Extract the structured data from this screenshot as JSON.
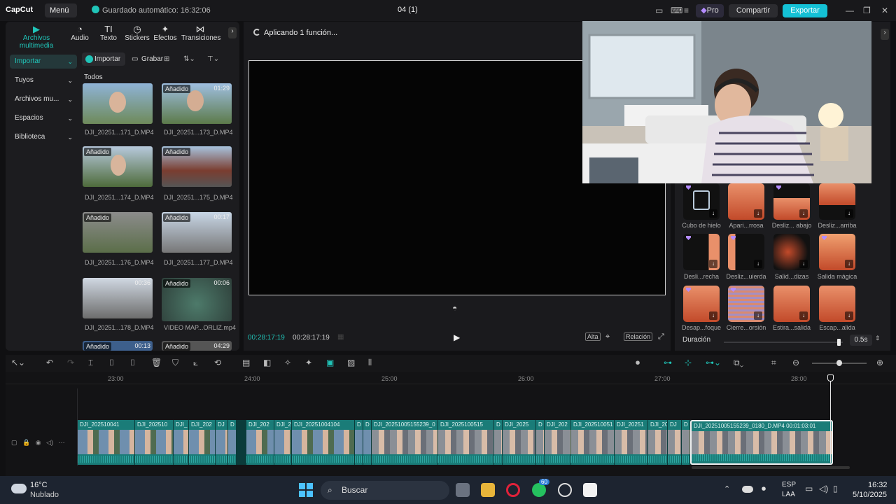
{
  "app": {
    "logo": "CapCut",
    "menu": "Menú",
    "autosave": "Guardado automático: 16:32:06",
    "project_title": "04 (1)",
    "pro": "Pro",
    "share": "Compartir",
    "export": "Exportar"
  },
  "left": {
    "tabs": [
      {
        "label": "Archivos multimedia",
        "icon": "media-icon"
      },
      {
        "label": "Audio",
        "icon": "audio-icon"
      },
      {
        "label": "Texto",
        "icon": "text-icon"
      },
      {
        "label": "Stickers",
        "icon": "sticker-icon"
      },
      {
        "label": "Efectos",
        "icon": "effects-icon"
      },
      {
        "label": "Transiciones",
        "icon": "transitions-icon"
      }
    ],
    "sidebar": [
      "Importar",
      "Tuyos",
      "Archivos mu...",
      "Espacios",
      "Biblioteca"
    ],
    "import_btn": "Importar",
    "record_btn": "Grabar",
    "section": "Todos",
    "media": [
      {
        "name": "DJI_20251...171_D.MP4",
        "badge": "",
        "dur": ""
      },
      {
        "name": "DJI_20251...173_D.MP4",
        "badge": "Añadido",
        "dur": "01:29"
      },
      {
        "name": "DJI_20251...174_D.MP4",
        "badge": "Añadido",
        "dur": ""
      },
      {
        "name": "DJI_20251...175_D.MP4",
        "badge": "Añadido",
        "dur": ""
      },
      {
        "name": "DJI_20251...176_D.MP4",
        "badge": "Añadido",
        "dur": ""
      },
      {
        "name": "DJI_20251...177_D.MP4",
        "badge": "Añadido",
        "dur": "00:17"
      },
      {
        "name": "DJI_20251...178_D.MP4",
        "badge": "",
        "dur": "00:36"
      },
      {
        "name": "VIDEO MAP...ORLIZ.mp4",
        "badge": "Añadido",
        "dur": "00:06"
      },
      {
        "name": "",
        "badge": "Añadido",
        "dur": "00:13"
      },
      {
        "name": "",
        "badge": "Añadido",
        "dur": "04:29"
      }
    ]
  },
  "preview": {
    "status": "Aplicando 1 función...",
    "current_time": "00:28:17:19",
    "total_time": "00:28:17:19",
    "quality": "Alta",
    "ratio": "Relación"
  },
  "effects": {
    "items": [
      {
        "label": "Cubo de hielo"
      },
      {
        "label": "Apari...rrosa"
      },
      {
        "label": "Desliz... abajo"
      },
      {
        "label": "Desliz...arriba"
      },
      {
        "label": "Desli...recha"
      },
      {
        "label": "Desliz...uierda"
      },
      {
        "label": "Salid...dizas"
      },
      {
        "label": "Salida mágica"
      },
      {
        "label": "Desap...foque"
      },
      {
        "label": "Cierre...orsión"
      },
      {
        "label": "Estira...salida"
      },
      {
        "label": "Escap...alida"
      }
    ],
    "duration_label": "Duración",
    "duration_value": "0.5s",
    "duration_fraction": 0.98
  },
  "timeline": {
    "ruler": [
      "23:00",
      "24:00",
      "25:00",
      "26:00",
      "27:00",
      "28:00"
    ],
    "clips": [
      {
        "name": "DJI_202510041"
      },
      {
        "name": "DJI_202510"
      },
      {
        "name": "DJI_"
      },
      {
        "name": "DJI_202"
      },
      {
        "name": "DJ"
      },
      {
        "name": "D"
      },
      {
        "name": "DJI_202"
      },
      {
        "name": "DJI_2"
      },
      {
        "name": "DJI_20251004104"
      },
      {
        "name": "D"
      },
      {
        "name": "D"
      },
      {
        "name": "DJI_20251005155239_0"
      },
      {
        "name": "DJI_2025100515"
      },
      {
        "name": "D"
      },
      {
        "name": "DJI_2025"
      },
      {
        "name": "D"
      },
      {
        "name": "DJI_202"
      },
      {
        "name": "DJI_202510051"
      },
      {
        "name": "DJI_20251"
      },
      {
        "name": "DJI_20"
      },
      {
        "name": "DJ"
      },
      {
        "name": "D"
      },
      {
        "name": "DJI_20251005155239_0180_D.MP4   00:01:03:01"
      }
    ],
    "zoom_fraction": 0.5
  },
  "taskbar": {
    "weather_temp": "16°C",
    "weather_desc": "Nublado",
    "search": "Buscar",
    "badge": "60",
    "lang": "ESP",
    "lang2": "LAA",
    "time": "16:32",
    "date": "5/10/2025"
  }
}
